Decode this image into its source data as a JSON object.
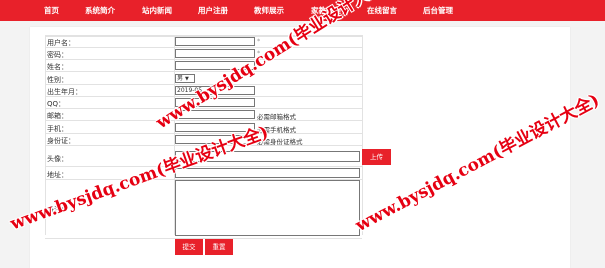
{
  "nav": {
    "items": [
      "首页",
      "系统简介",
      "站内新闻",
      "用户注册",
      "教师展示",
      "家教课程",
      "在线留言",
      "后台管理"
    ]
  },
  "form": {
    "labels": {
      "username": "用户名：",
      "password": "密码：",
      "name": "姓名：",
      "gender": "性别：",
      "birth": "出生年月：",
      "qq": "QQ：",
      "email": "邮箱：",
      "phone": "手机：",
      "idcard": "身份证：",
      "avatar": "头像：",
      "address": "地址：",
      "remark": "备注："
    },
    "required_mark": "*",
    "gender_value": "男",
    "birth_value": "2019-05",
    "notes": {
      "email": "必需邮箱格式",
      "phone": "必需手机格式",
      "idcard": "必需身份证格式"
    },
    "upload_label": "上传",
    "submit_label": "提交",
    "reset_label": "重置"
  },
  "watermarks": [
    "www.bysjdq.com(毕业设计大全)"
  ],
  "colors": {
    "accent": "#e8212a",
    "watermark": "#e60012"
  }
}
